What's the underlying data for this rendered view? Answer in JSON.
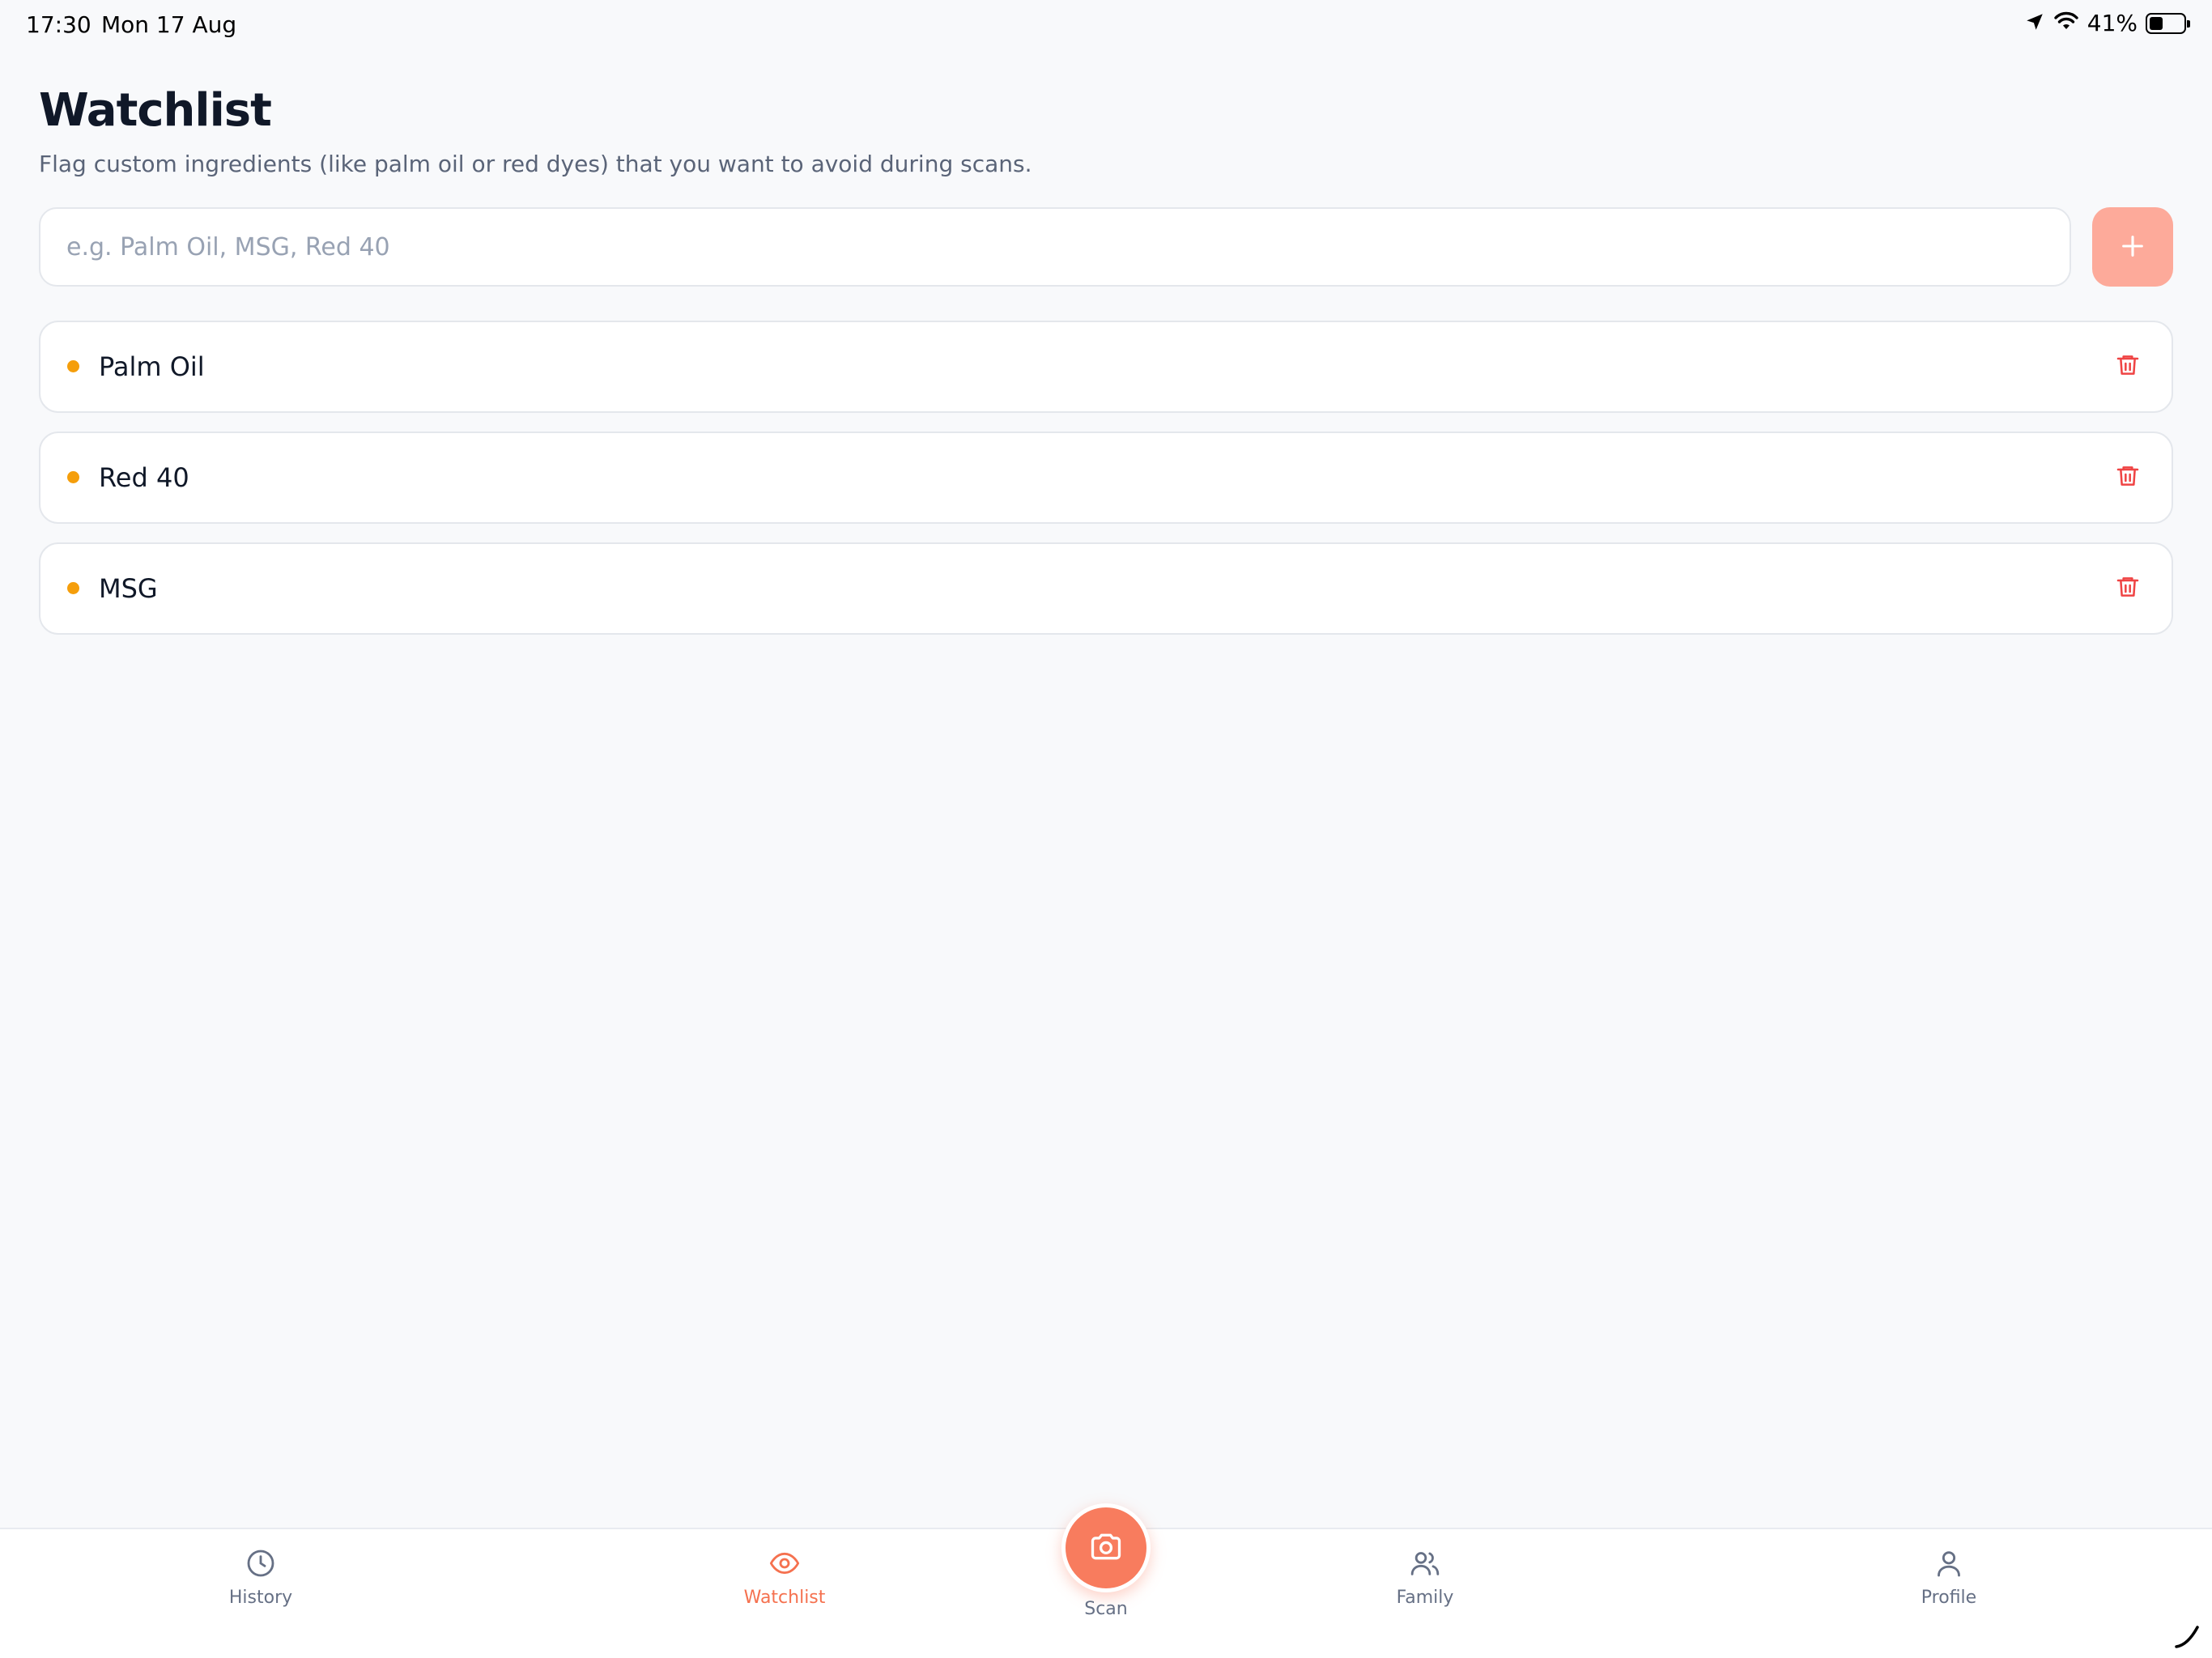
{
  "status_bar": {
    "time": "17:30",
    "date": "Mon 17 Aug",
    "battery": "41%",
    "battery_level": 0.41,
    "icons": [
      "location-icon",
      "wifi-icon",
      "battery-icon"
    ]
  },
  "header": {
    "title": "Watchlist",
    "subtitle": "Flag custom ingredients (like palm oil or red dyes) that you want to avoid during scans."
  },
  "add_form": {
    "placeholder": "e.g. Palm Oil, MSG, Red 40",
    "value": "",
    "add_icon": "plus-icon"
  },
  "watchlist": {
    "items": [
      {
        "label": "Palm Oil"
      },
      {
        "label": "Red 40"
      },
      {
        "label": "MSG"
      }
    ],
    "delete_icon": "trash-icon"
  },
  "tab_bar": {
    "tabs": [
      {
        "label": "History",
        "icon": "clock-icon",
        "active": false
      },
      {
        "label": "Watchlist",
        "icon": "eye-icon",
        "active": true
      },
      {
        "label": "Scan",
        "icon": "camera-icon",
        "active": false
      },
      {
        "label": "Family",
        "icon": "users-icon",
        "active": false
      },
      {
        "label": "Profile",
        "icon": "user-icon",
        "active": false
      }
    ]
  },
  "colors": {
    "accent": "#f87c5e",
    "accent_light": "#fdaa9a",
    "dot": "#f59e0b",
    "delete": "#ef4444",
    "background": "#f8f9fb",
    "text": "#101828",
    "muted": "#667085"
  }
}
